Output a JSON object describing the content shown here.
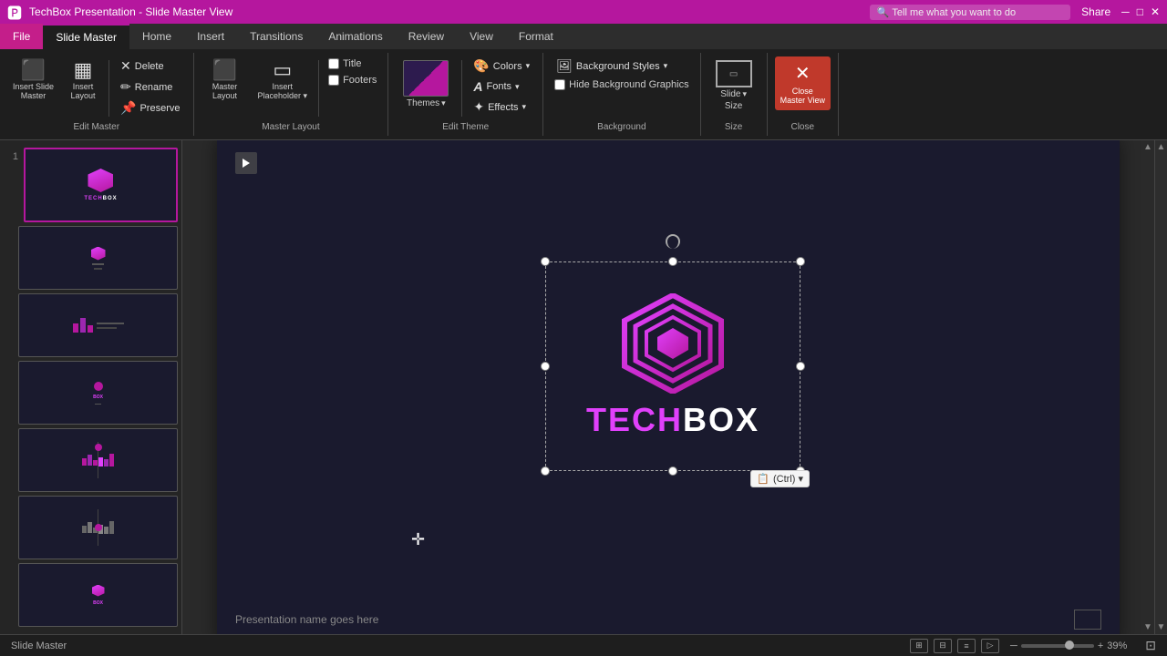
{
  "titlebar": {
    "app": "PowerPoint",
    "filename": "TechBox Presentation - Slide Master View",
    "share_label": "Share",
    "search_placeholder": "Tell me what you want to do"
  },
  "tabs": [
    {
      "id": "file",
      "label": "File",
      "active": false
    },
    {
      "id": "slide-master",
      "label": "Slide Master",
      "active": true
    },
    {
      "id": "home",
      "label": "Home",
      "active": false
    },
    {
      "id": "insert",
      "label": "Insert",
      "active": false
    },
    {
      "id": "transitions",
      "label": "Transitions",
      "active": false
    },
    {
      "id": "animations",
      "label": "Animations",
      "active": false
    },
    {
      "id": "review",
      "label": "Review",
      "active": false
    },
    {
      "id": "view",
      "label": "View",
      "active": false
    },
    {
      "id": "format",
      "label": "Format",
      "active": false
    }
  ],
  "ribbon": {
    "groups": [
      {
        "id": "edit-master",
        "label": "Edit Master",
        "buttons": [
          {
            "id": "insert-slide-master",
            "label": "Insert Slide\nMaster",
            "icon": "⬛"
          },
          {
            "id": "insert-layout",
            "label": "Insert\nLayout",
            "icon": "▦"
          },
          {
            "id": "delete",
            "label": "Delete",
            "icon": "✕"
          },
          {
            "id": "rename",
            "label": "Rename",
            "icon": "✏"
          },
          {
            "id": "preserve",
            "label": "Preserve",
            "icon": "📌"
          }
        ]
      },
      {
        "id": "master-layout",
        "label": "Master Layout",
        "buttons": [
          {
            "id": "master-layout-btn",
            "label": "Master\nLayout",
            "icon": "⬛"
          },
          {
            "id": "insert-placeholder",
            "label": "Insert\nPlaceholder",
            "icon": "▭"
          },
          {
            "id": "title-cb",
            "label": "Title",
            "checkbox": true
          },
          {
            "id": "footers-cb",
            "label": "Footers",
            "checkbox": true
          }
        ]
      },
      {
        "id": "edit-theme",
        "label": "Edit Theme",
        "buttons": [
          {
            "id": "themes",
            "label": "Themes",
            "icon": "🎨"
          },
          {
            "id": "colors",
            "label": "Colors",
            "icon": "🎨"
          },
          {
            "id": "fonts",
            "label": "Fonts",
            "icon": "A"
          },
          {
            "id": "effects",
            "label": "Effects",
            "icon": "✦"
          }
        ]
      },
      {
        "id": "background",
        "label": "Background",
        "buttons": [
          {
            "id": "background-styles",
            "label": "Background Styles",
            "icon": "🖼"
          },
          {
            "id": "hide-bg-graphics",
            "label": "Hide Background Graphics",
            "checkbox": true
          }
        ]
      },
      {
        "id": "size",
        "label": "Size",
        "buttons": [
          {
            "id": "slide-size",
            "label": "Slide\nSize",
            "icon": "⬛"
          }
        ]
      },
      {
        "id": "close",
        "label": "Close",
        "buttons": [
          {
            "id": "close-master-view",
            "label": "Close\nMaster View",
            "icon": "✕"
          }
        ]
      }
    ],
    "colors_label": "Colors",
    "fonts_label": "Fonts",
    "effects_label": "Effects",
    "bg_styles_label": "Background Styles",
    "hide_bg_label": "Hide Background Graphics",
    "themes_label": "Themes",
    "slide_size_label": "Slide\nSize",
    "close_label": "Close\nMaster View",
    "master_layout_label": "Master\nLayout",
    "insert_placeholder_label": "Insert\nPlaceholder",
    "insert_slide_master_label": "Insert Slide\nMaster",
    "insert_layout_label": "Insert\nLayout",
    "delete_label": "Delete",
    "rename_label": "Rename",
    "preserve_label": "Preserve",
    "title_label": "Title",
    "footers_label": "Footers",
    "edit_master_group": "Edit Master",
    "master_layout_group": "Master Layout",
    "edit_theme_group": "Edit Theme",
    "background_group": "Background",
    "size_group": "Size",
    "close_group": "Close"
  },
  "slides": [
    {
      "number": "1",
      "selected": true,
      "type": "master"
    },
    {
      "number": "",
      "selected": false,
      "type": "layout1"
    },
    {
      "number": "",
      "selected": false,
      "type": "layout2"
    },
    {
      "number": "",
      "selected": false,
      "type": "layout3"
    },
    {
      "number": "",
      "selected": false,
      "type": "layout4"
    },
    {
      "number": "",
      "selected": false,
      "type": "layout5"
    },
    {
      "number": "",
      "selected": false,
      "type": "layout6"
    }
  ],
  "canvas": {
    "logo_text_tech": "TECH",
    "logo_text_box": "BOX",
    "footer_text": "Presentation name goes here",
    "play_btn_title": "Play"
  },
  "statusbar": {
    "view": "Slide Master",
    "slide_count": "",
    "zoom_label": "39%",
    "zoom_value": 39
  },
  "ctrl_tooltip": "(Ctrl) ▾"
}
